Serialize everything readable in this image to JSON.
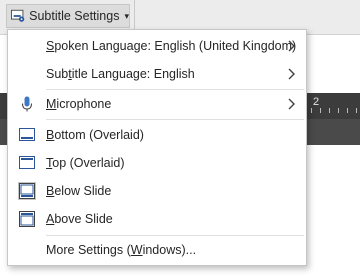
{
  "toolbar": {
    "subtitle_settings": {
      "prefix": "Subtitle Settings"
    },
    "ruler_number": "2"
  },
  "menu": {
    "spoken_language": {
      "pre": "",
      "mnemonic": "S",
      "post": "poken Language: English (United Kingdom)"
    },
    "subtitle_language": {
      "pre": "Sub",
      "mnemonic": "t",
      "post": "itle Language: English"
    },
    "microphone": {
      "pre": "",
      "mnemonic": "M",
      "post": "icrophone"
    },
    "bottom_overlaid": {
      "pre": "",
      "mnemonic": "B",
      "post": "ottom (Overlaid)"
    },
    "top_overlaid": {
      "pre": "",
      "mnemonic": "T",
      "post": "op (Overlaid)"
    },
    "below_slide": {
      "pre": "",
      "mnemonic": "B",
      "post": "elow Slide"
    },
    "above_slide": {
      "pre": "",
      "mnemonic": "A",
      "post": "bove Slide"
    },
    "more_settings": {
      "pre": "More Settings (",
      "mnemonic": "W",
      "post": "indows)..."
    }
  },
  "colors": {
    "accent_blue": "#2b579a",
    "mic_blue": "#3c78c3",
    "selected_fill": "#c5c5c5",
    "separator": "#e0e0e0"
  },
  "icons": [
    "subtitle-settings-icon",
    "chevron-down-icon",
    "chevron-right-icon",
    "microphone-icon",
    "position-bottom-icon",
    "position-top-icon",
    "position-below-icon",
    "position-above-icon"
  ]
}
